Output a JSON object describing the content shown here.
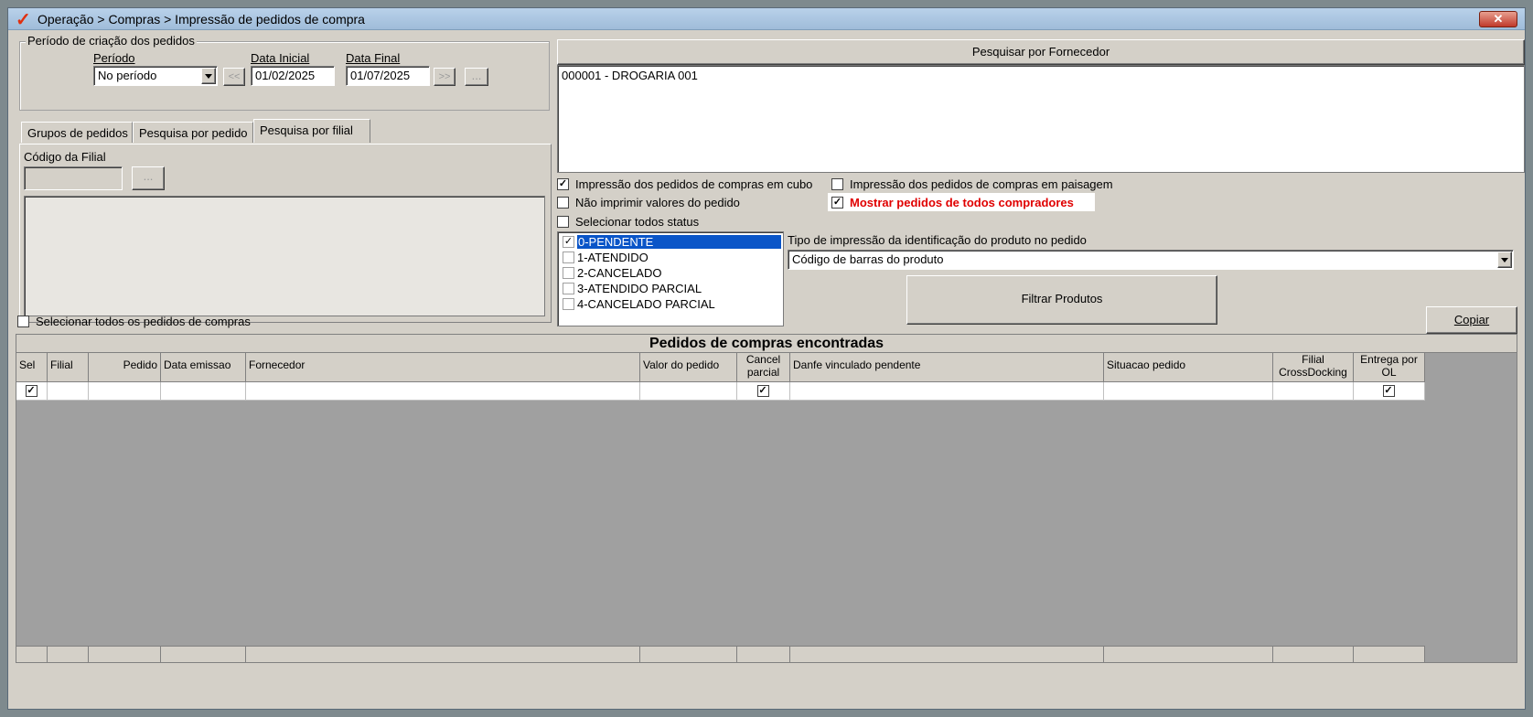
{
  "window": {
    "title": "Operação > Compras > Impressão de pedidos de compra",
    "close_label": "✕"
  },
  "period_group": {
    "legend": "Período de criação dos pedidos",
    "period_label": "Período",
    "period_value": "No período",
    "start_label": "Data Inicial",
    "start_value": "01/02/2025",
    "end_label": "Data Final",
    "end_value": "01/07/2025",
    "prev_label": "<<",
    "next_label": ">>",
    "more_label": "..."
  },
  "tabs": [
    "Grupos de pedidos",
    "Pesquisa por pedido",
    "Pesquisa por filial"
  ],
  "filial": {
    "code_label": "Código da Filial",
    "code_value": "",
    "lookup_label": "..."
  },
  "select_all_orders": {
    "label": "Selecionar todos os pedidos de compras",
    "checked": false
  },
  "supplier": {
    "button_label": "Pesquisar por Fornecedor",
    "items": [
      "000001 - DROGARIA 001"
    ]
  },
  "options": {
    "cube": {
      "label": "Impressão dos pedidos de compras em cubo",
      "checked": true
    },
    "landscape": {
      "label": "Impressão dos pedidos de compras em paisagem",
      "checked": false
    },
    "no_values": {
      "label": "Não imprimir valores do pedido",
      "checked": false
    },
    "all_buyers": {
      "label": "Mostrar pedidos de todos compradores",
      "checked": true,
      "color": "#e00000"
    },
    "all_status": {
      "label": "Selecionar todos status",
      "checked": false
    }
  },
  "status_list": [
    {
      "label": "0-PENDENTE",
      "checked": true,
      "selected": true
    },
    {
      "label": "1-ATENDIDO",
      "checked": false,
      "selected": false
    },
    {
      "label": "2-CANCELADO",
      "checked": false,
      "selected": false
    },
    {
      "label": "3-ATENDIDO PARCIAL",
      "checked": false,
      "selected": false
    },
    {
      "label": "4-CANCELADO PARCIAL",
      "checked": false,
      "selected": false
    }
  ],
  "print_type": {
    "label": "Tipo de impressão da identificação do produto no pedido",
    "value": "Código de barras do produto"
  },
  "buttons": {
    "filter_products": "Filtrar Produtos",
    "copy": "Copiar"
  },
  "grid": {
    "title": "Pedidos de compras encontradas",
    "columns": [
      "Sel",
      "Filial",
      "Pedido",
      "Data emissao",
      "Fornecedor",
      "Valor do pedido",
      "Cancel parcial",
      "Danfe vinculado pendente",
      "Situacao pedido",
      "Filial CrossDocking",
      "Entrega por OL"
    ],
    "row": {
      "sel": true,
      "cancel_parcial": true,
      "entrega_ol": true
    }
  },
  "colors": {
    "accent_selection": "#0a55c8",
    "title_gradient": "#b9d1ea"
  }
}
